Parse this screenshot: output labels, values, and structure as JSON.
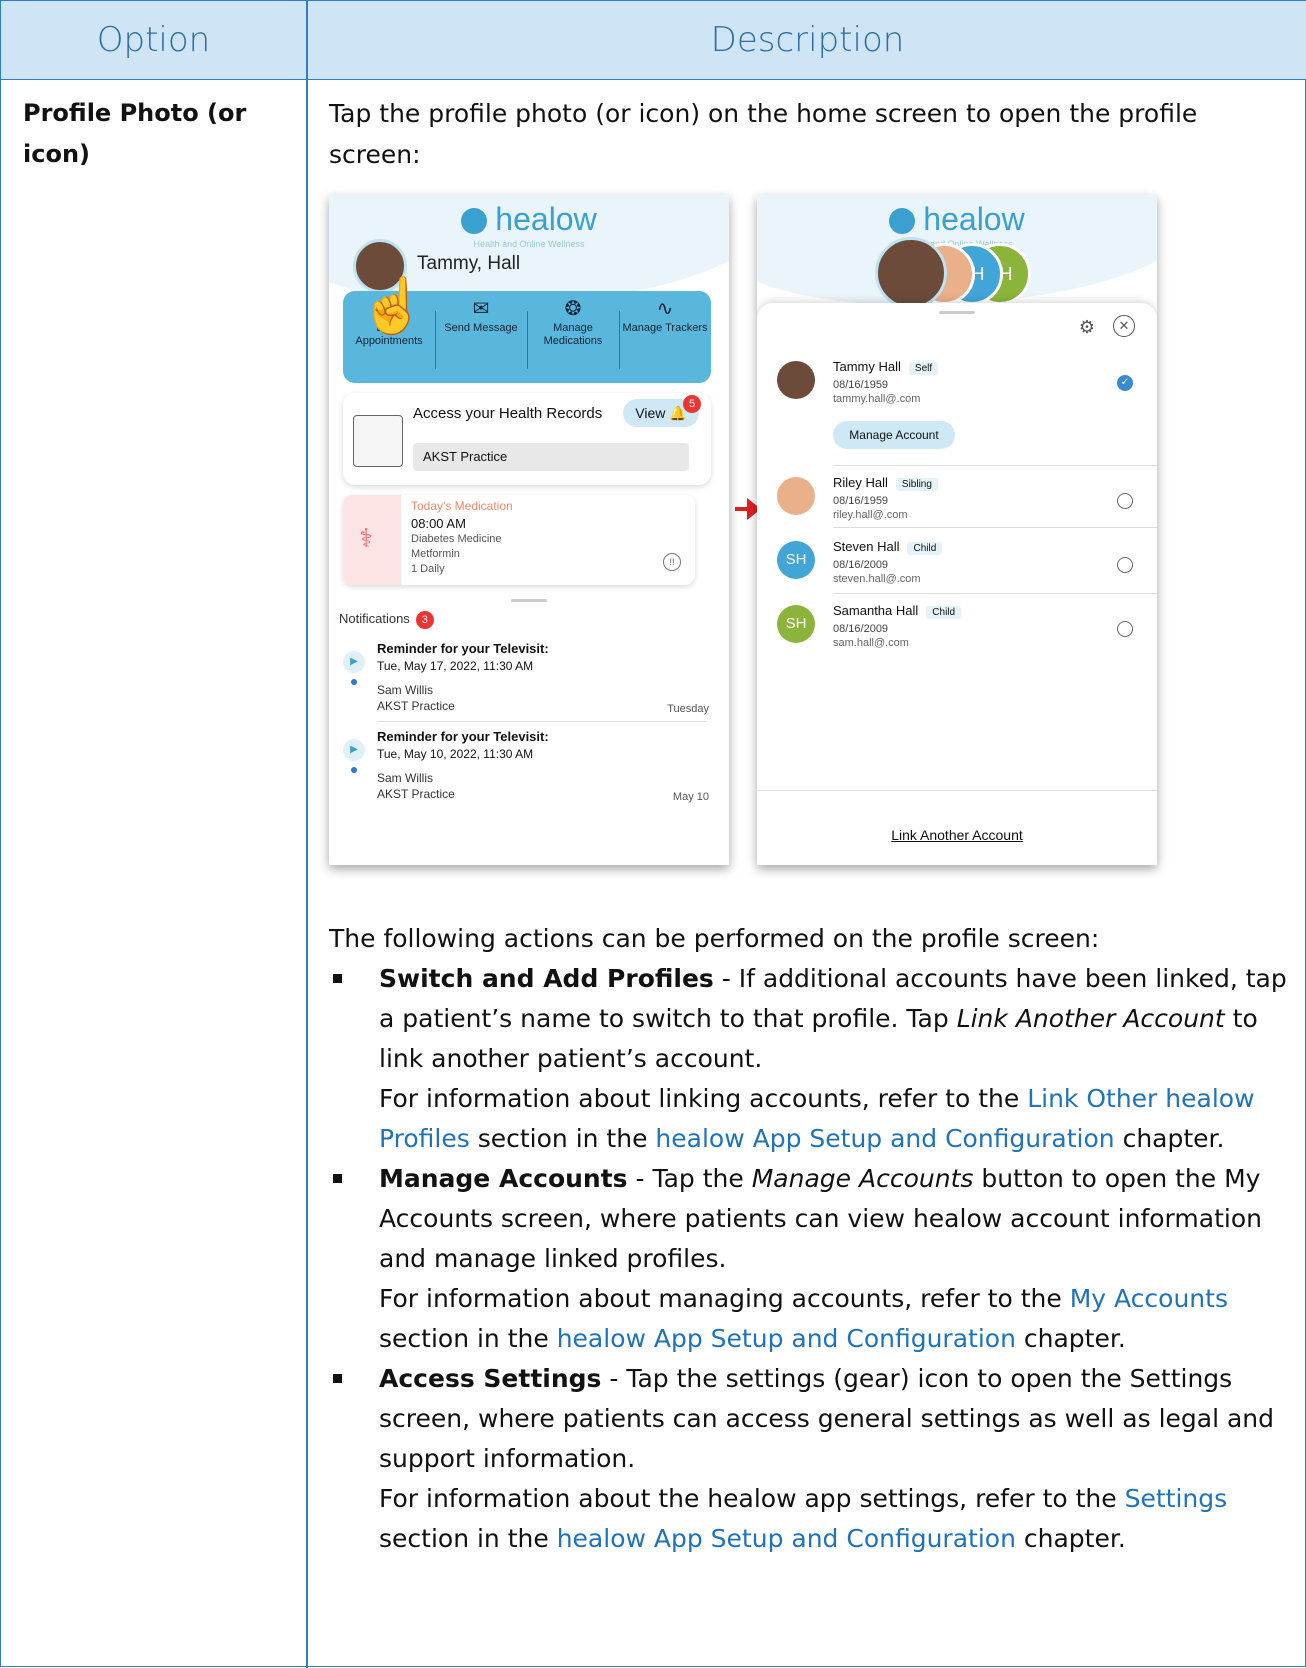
{
  "header": {
    "option": "Option",
    "description": "Description"
  },
  "row": {
    "option": "Profile Photo (or icon)",
    "intro": "Tap the profile photo (or icon) on the home screen to open the profile screen:",
    "after": "The following actions can be performed on the profile screen:"
  },
  "bullets": [
    {
      "title": "Switch and Add Profiles",
      "sep": " - ",
      "t1": "If additional accounts have been linked, tap a patient’s name to switch to that profile. Tap ",
      "i1": "Link Another Account",
      "t2": " to link another patient’s account.",
      "t3": "For information about linking accounts, refer to the ",
      "l1": "Link Other healow Profiles",
      "t4": " section in the ",
      "l2": "healow App Setup and Configuration",
      "t5": " chapter."
    },
    {
      "title": "Manage Accounts",
      "sep": " - ",
      "t1": "Tap the ",
      "i1": "Manage Accounts",
      "t2": " button to open the My Accounts screen, where patients can view healow account information and manage linked profiles.",
      "t3": "For information about managing accounts, refer to the ",
      "l1": "My Accounts",
      "t4": " section in the ",
      "l2": "healow App Setup and Configuration",
      "t5": " chapter."
    },
    {
      "title": "Access Settings",
      "sep": " - ",
      "t1": "Tap the settings (gear) icon to open the Settings screen, where patients can access general settings as well as legal and support information.",
      "t3": "For information about the healow app settings, refer to the ",
      "l1": "Settings",
      "t4": " section in the ",
      "l2": "healow App Setup and Configuration",
      "t5": " chapter."
    }
  ],
  "home": {
    "logo": "healow",
    "tagline": "Health and Online Wellness",
    "user": "Tammy, Hall",
    "quick": [
      "Book Appointments",
      "Send Message",
      "Manage Medications",
      "Manage Trackers"
    ],
    "records_title": "Access your Health Records",
    "view": "View",
    "view_badge": "5",
    "practice": "AKST Practice",
    "med_title": "Today's Medication",
    "med_time": "08:00 AM",
    "med_lines": [
      "Diabetes Medicine",
      "Metformin",
      "1 Daily"
    ],
    "notif_label": "Notifications",
    "notif_count": "3",
    "notifications": [
      {
        "title": "Reminder for your Televisit:",
        "date": "Tue, May 17, 2022, 11:30 AM",
        "name": "Sam Willis",
        "practice": "AKST Practice",
        "when": "Tuesday"
      },
      {
        "title": "Reminder for your Televisit:",
        "date": "Tue, May 10, 2022, 11:30 AM",
        "name": "Sam Willis",
        "practice": "AKST Practice",
        "when": "May 10"
      }
    ]
  },
  "profile": {
    "logo": "healow",
    "tagline": "Health and Online Wellness",
    "initials": "SH",
    "people": [
      {
        "name": "Tammy Hall",
        "tag": "Self",
        "dob": "08/16/1959",
        "email": "tammy.hall@.com",
        "initials": "",
        "color": "#6d4b3a"
      },
      {
        "name": "Riley Hall",
        "tag": "Sibling",
        "dob": "08/16/1959",
        "email": "riley.hall@.com",
        "initials": "",
        "color": "#e9b08a"
      },
      {
        "name": "Steven Hall",
        "tag": "Child",
        "dob": "08/16/2009",
        "email": "steven.hall@.com",
        "initials": "SH",
        "color": "#42a5d8"
      },
      {
        "name": "Samantha Hall",
        "tag": "Child",
        "dob": "08/16/2009",
        "email": "sam.hall@.com",
        "initials": "SH",
        "color": "#8cb43a"
      }
    ],
    "manage": "Manage Account",
    "link": "Link Another Account"
  }
}
